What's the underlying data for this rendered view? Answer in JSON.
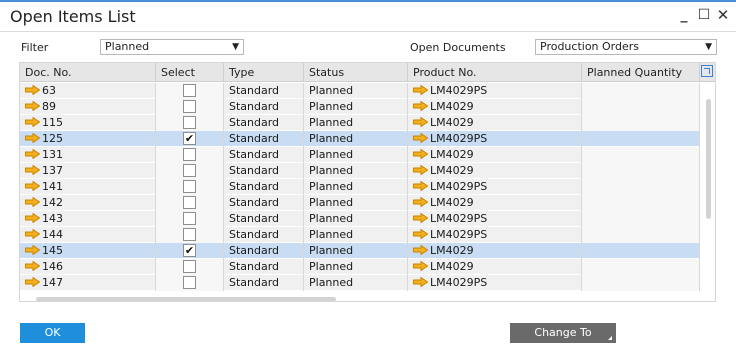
{
  "window": {
    "title": "Open Items List"
  },
  "filter": {
    "label": "Filter",
    "value": "Planned"
  },
  "open_documents": {
    "label": "Open Documents",
    "value": "Production Orders"
  },
  "table": {
    "columns": [
      "Doc. No.",
      "Select",
      "Type",
      "Status",
      "Product No.",
      "Planned Quantity"
    ],
    "rows": [
      {
        "doc": "63",
        "selected": false,
        "type": "Standard",
        "status": "Planned",
        "product": "LM4029PS",
        "qty": ""
      },
      {
        "doc": "89",
        "selected": false,
        "type": "Standard",
        "status": "Planned",
        "product": "LM4029",
        "qty": ""
      },
      {
        "doc": "115",
        "selected": false,
        "type": "Standard",
        "status": "Planned",
        "product": "LM4029",
        "qty": ""
      },
      {
        "doc": "125",
        "selected": true,
        "type": "Standard",
        "status": "Planned",
        "product": "LM4029PS",
        "qty": ""
      },
      {
        "doc": "131",
        "selected": false,
        "type": "Standard",
        "status": "Planned",
        "product": "LM4029",
        "qty": ""
      },
      {
        "doc": "137",
        "selected": false,
        "type": "Standard",
        "status": "Planned",
        "product": "LM4029",
        "qty": ""
      },
      {
        "doc": "141",
        "selected": false,
        "type": "Standard",
        "status": "Planned",
        "product": "LM4029PS",
        "qty": ""
      },
      {
        "doc": "142",
        "selected": false,
        "type": "Standard",
        "status": "Planned",
        "product": "LM4029",
        "qty": ""
      },
      {
        "doc": "143",
        "selected": false,
        "type": "Standard",
        "status": "Planned",
        "product": "LM4029PS",
        "qty": ""
      },
      {
        "doc": "144",
        "selected": false,
        "type": "Standard",
        "status": "Planned",
        "product": "LM4029PS",
        "qty": ""
      },
      {
        "doc": "145",
        "selected": true,
        "type": "Standard",
        "status": "Planned",
        "product": "LM4029",
        "qty": ""
      },
      {
        "doc": "146",
        "selected": false,
        "type": "Standard",
        "status": "Planned",
        "product": "LM4029",
        "qty": ""
      },
      {
        "doc": "147",
        "selected": false,
        "type": "Standard",
        "status": "Planned",
        "product": "LM4029PS",
        "qty": ""
      }
    ]
  },
  "buttons": {
    "ok": "OK",
    "change_to": "Change To"
  },
  "colors": {
    "accent": "#1f8fdc",
    "link_arrow": "#e8a000",
    "selected_row": "#c8ddf3"
  },
  "icons": {
    "link": "link-arrow-icon",
    "minimize": "minimize-icon",
    "maximize": "maximize-icon",
    "close": "close-icon",
    "expand": "expand-icon"
  }
}
